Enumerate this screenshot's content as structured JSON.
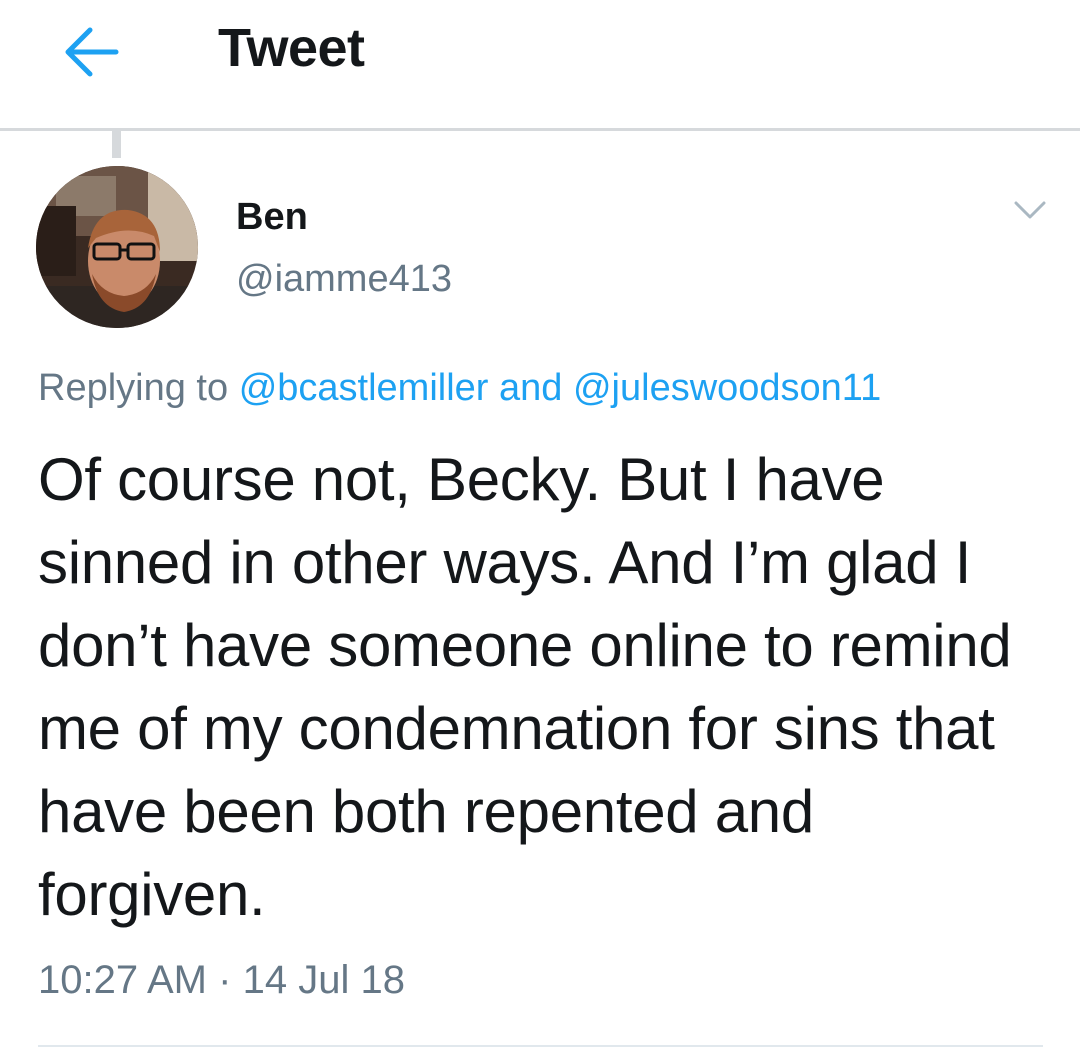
{
  "header": {
    "title": "Tweet",
    "back_icon": "arrow-left-icon",
    "accent_color": "#1da1f2"
  },
  "tweet": {
    "author": {
      "display_name": "Ben",
      "handle": "@iamme413"
    },
    "menu_icon": "chevron-down-icon",
    "replying": {
      "prefix": "Replying to",
      "mention_1": "@bcastlemiller",
      "conjunction": "and",
      "mention_2": "@juleswoodson11"
    },
    "text": "Of course not, Becky. But I have sinned in other ways. And I’m glad I don’t have someone online to remind me of my condemnation for sins that have been both repented and forgiven.",
    "time": "10:27 AM",
    "separator": "·",
    "date": "14 Jul 18"
  }
}
